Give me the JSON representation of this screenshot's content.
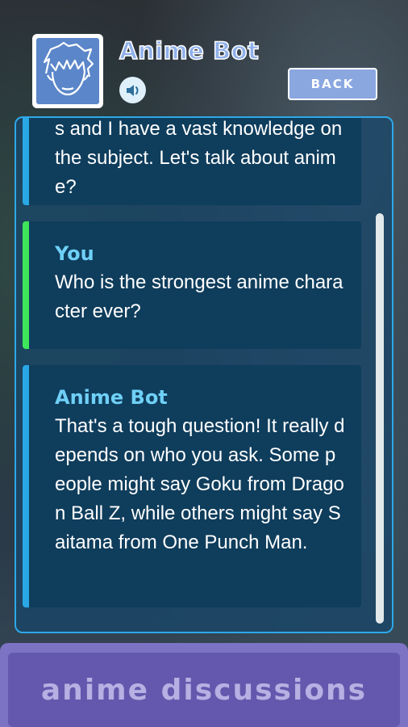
{
  "header": {
    "title": "Anime Bot",
    "back_label": "BACK",
    "avatar_icon": "anime-face-icon",
    "speaker_icon": "speaker-icon"
  },
  "messages": [
    {
      "sender": "",
      "text": "s and I have a vast knowledge on the subject. Let's talk about anime?",
      "accent": "#2aa8e6"
    },
    {
      "sender": "You",
      "text": "Who is the strongest anime character ever?",
      "accent": "#3ee65a"
    },
    {
      "sender": "Anime Bot",
      "text": "That's a tough question! It really depends on who you ask. Some people might say Goku from Dragon Ball Z, while others might say Saitama from One Punch Man.",
      "accent": "#2aa8e6"
    }
  ],
  "bottom": {
    "label": "anime discussions"
  },
  "colors": {
    "panel_border": "#2da8e8",
    "bot_sender": "#6fd0f7",
    "user_sender": "#6fd0f7",
    "bottom_bg": "#6358ad"
  }
}
